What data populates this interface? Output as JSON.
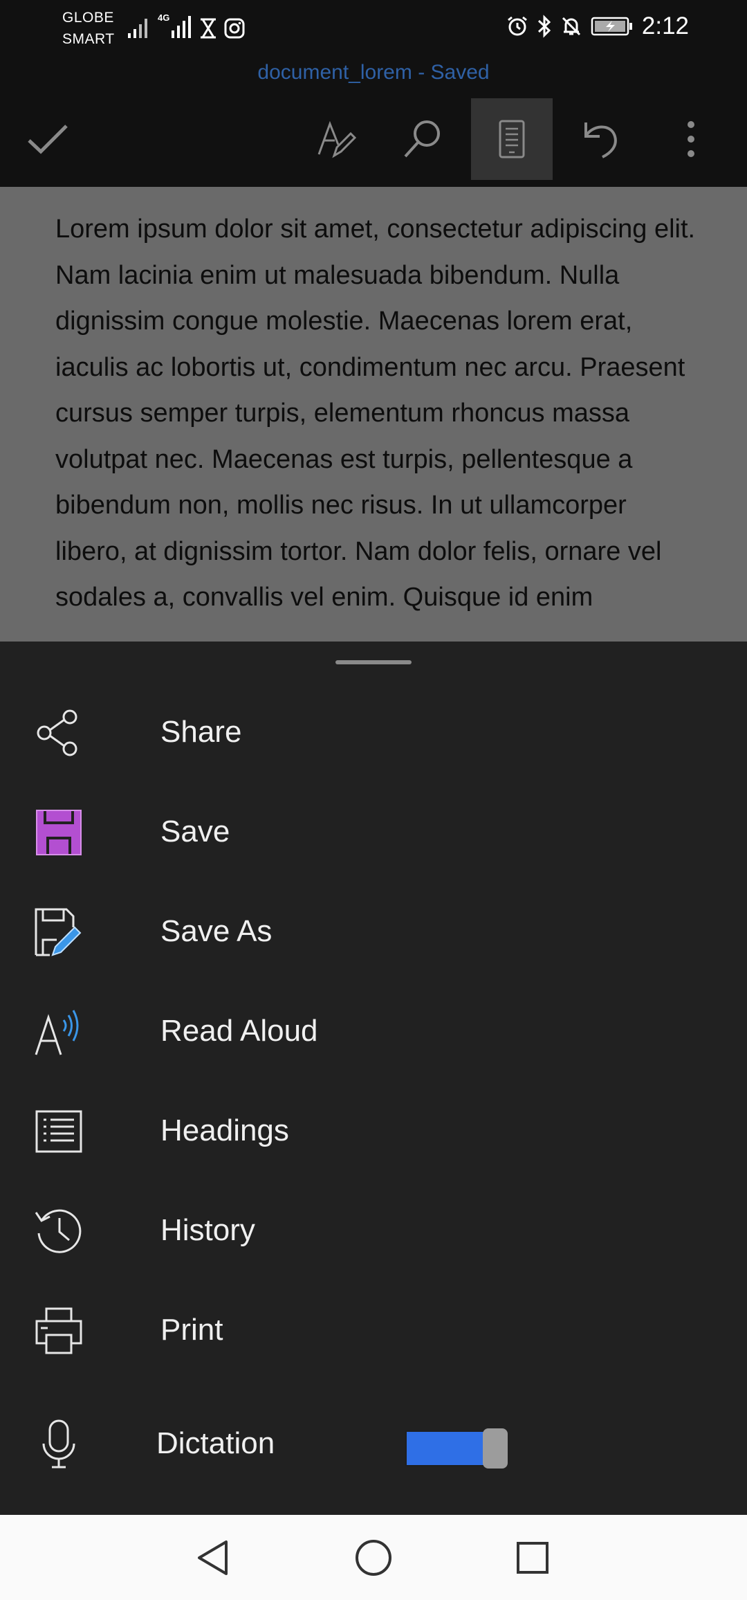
{
  "status_bar": {
    "carrier_line1": "GLOBE",
    "carrier_line2": "SMART",
    "network_badge": "4G",
    "time": "2:12"
  },
  "toolbar": {
    "document_title": "document_lorem - Saved"
  },
  "document": {
    "body": "Lorem ipsum dolor sit amet, consectetur adipiscing elit. Nam lacinia enim ut malesuada bibendum. Nulla dignissim congue molestie. Maecenas lorem erat, iaculis ac lobortis ut, condimentum nec arcu. Praesent cursus semper turpis, elementum rhoncus massa volutpat nec. Maecenas est turpis, pellentesque a bibendum non, mollis nec risus. In ut ullamcorper libero, at dignissim tortor. Nam dolor felis, ornare vel sodales a, convallis vel enim. Quisque id enim"
  },
  "menu": {
    "items": [
      {
        "label": "Share",
        "icon": "share-icon"
      },
      {
        "label": "Save",
        "icon": "save-icon"
      },
      {
        "label": "Save As",
        "icon": "save-as-icon"
      },
      {
        "label": "Read Aloud",
        "icon": "read-aloud-icon"
      },
      {
        "label": "Headings",
        "icon": "headings-icon"
      },
      {
        "label": "History",
        "icon": "history-icon"
      },
      {
        "label": "Print",
        "icon": "print-icon"
      },
      {
        "label": "Dictation",
        "icon": "microphone-icon"
      }
    ],
    "dictation_toggle_on": true
  },
  "colors": {
    "title": "#2f61a6",
    "save_icon": "#b34fd1",
    "accent_blue": "#2f6fe6",
    "sheet_background": "#212121"
  }
}
